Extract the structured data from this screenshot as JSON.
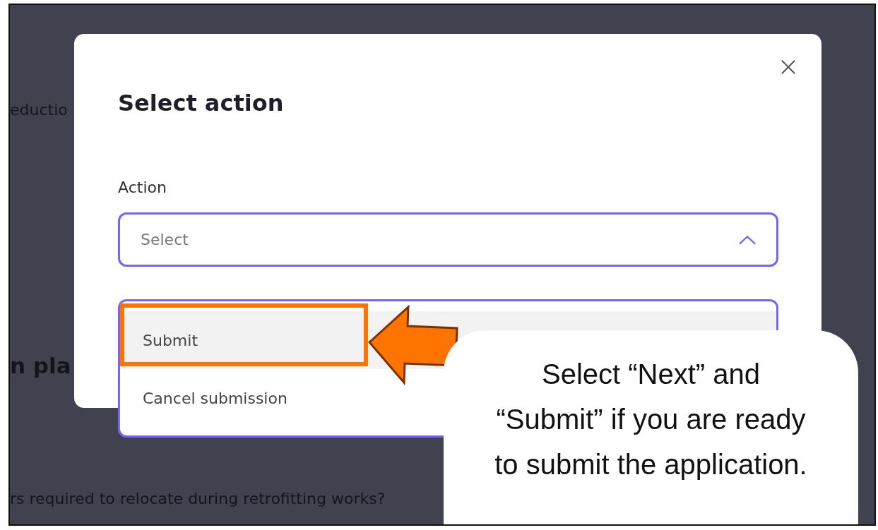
{
  "background": {
    "texts": [
      {
        "text": "eductio",
        "kind": "body"
      },
      {
        "text": "n pla",
        "kind": "heading"
      },
      {
        "text": "rs required to relocate during retrofitting works?",
        "kind": "body"
      }
    ]
  },
  "modal": {
    "title": "Select action",
    "field": {
      "label": "Action",
      "placeholder": "Select",
      "expanded": true
    },
    "options": [
      {
        "label": "Submit",
        "selected": true
      },
      {
        "label": "Cancel submission",
        "selected": false
      }
    ]
  },
  "annotation": {
    "callout": "Select “Next” and “Submit” if you are ready to submit the application."
  }
}
